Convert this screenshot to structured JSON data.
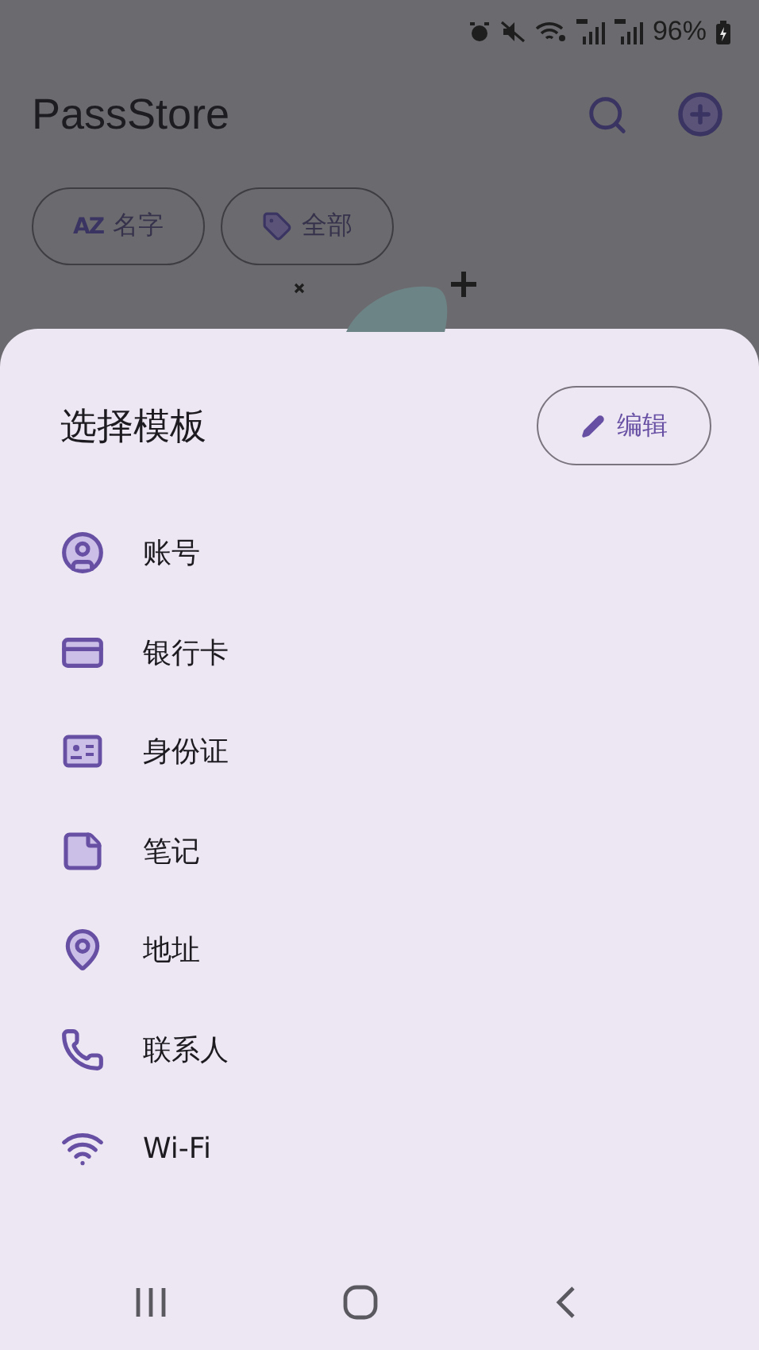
{
  "status_bar": {
    "battery": "96%"
  },
  "app_bar": {
    "title": "PassStore"
  },
  "chips": [
    {
      "kind": "sort",
      "icon_text": "AZ",
      "label": "名字"
    },
    {
      "kind": "tag",
      "label": "全部"
    }
  ],
  "sheet": {
    "title": "选择模板",
    "edit_button": "编辑",
    "items": [
      {
        "kind": "account",
        "label": "账号"
      },
      {
        "kind": "card",
        "label": "银行卡"
      },
      {
        "kind": "id",
        "label": "身份证"
      },
      {
        "kind": "note",
        "label": "笔记"
      },
      {
        "kind": "address",
        "label": "地址"
      },
      {
        "kind": "contact",
        "label": "联系人"
      },
      {
        "kind": "wifi",
        "label": "Wi-Fi"
      }
    ]
  }
}
